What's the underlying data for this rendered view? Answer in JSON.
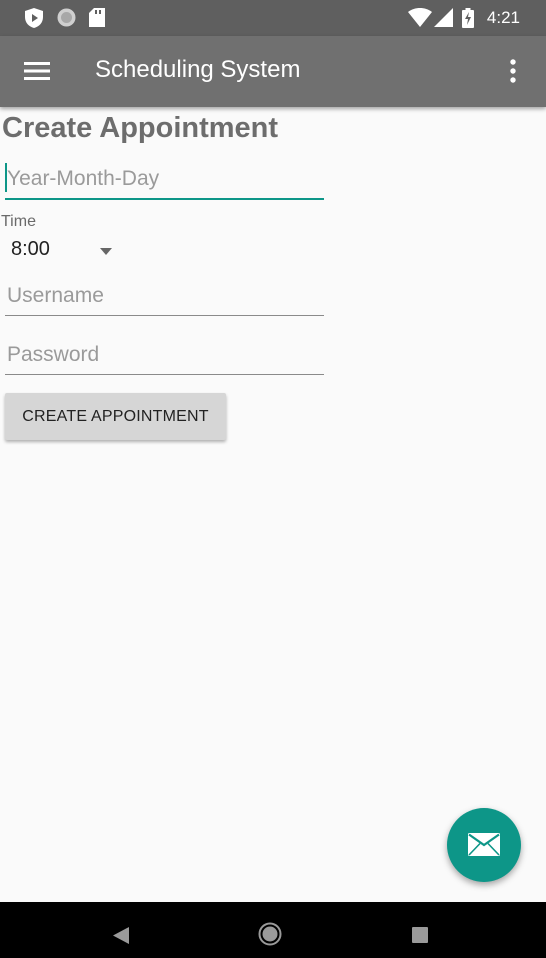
{
  "status_bar": {
    "time": "4:21",
    "icons": [
      "shield-icon",
      "circle-notification-icon",
      "sd-card-icon",
      "wifi-icon",
      "signal-icon",
      "battery-charging-icon"
    ]
  },
  "app_bar": {
    "title": "Scheduling System",
    "menu_icon": "hamburger-menu-icon",
    "overflow_icon": "more-vertical-icon"
  },
  "form": {
    "heading": "Create Appointment",
    "date_placeholder": "Year-Month-Day",
    "time_label": "Time",
    "time_value": "8:00",
    "username_placeholder": "Username",
    "password_placeholder": "Password",
    "submit_label": "CREATE APPOINTMENT"
  },
  "fab": {
    "icon": "mail-icon"
  },
  "nav_bar": {
    "icons": [
      "back-icon",
      "home-icon",
      "recents-icon"
    ]
  },
  "colors": {
    "accent": "#0d9688",
    "app_bar": "#707070",
    "status_bar": "#5f5f5f"
  }
}
